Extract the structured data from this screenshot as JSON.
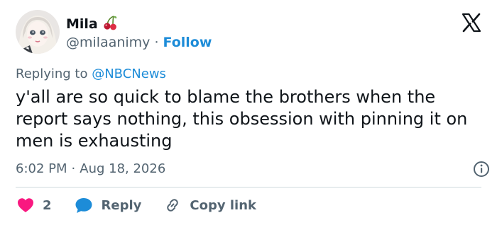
{
  "author": {
    "display_name": "Mila",
    "name_emoji": "cherry-emoji",
    "handle": "@milaanimy",
    "separator": "·",
    "follow_label": "Follow"
  },
  "reply_context": {
    "prefix": "Replying to",
    "mention": "@NBCNews"
  },
  "tweet": {
    "text": "y'all are so quick to blame the brothers when the report says nothing, this obsession with pinning it on men is exhausting",
    "time": "6:02 PM",
    "separator": "·",
    "date": "Aug 18, 2026"
  },
  "actions": {
    "like_count": "2",
    "reply_label": "Reply",
    "copy_label": "Copy link"
  },
  "colors": {
    "accent": "#1d8cd8",
    "like": "#f91880",
    "text": "#0f1419",
    "muted": "#536471"
  },
  "icons": [
    "x-logo-icon",
    "info-icon",
    "heart-icon",
    "reply-bubble-icon",
    "link-icon",
    "cherry-emoji"
  ]
}
